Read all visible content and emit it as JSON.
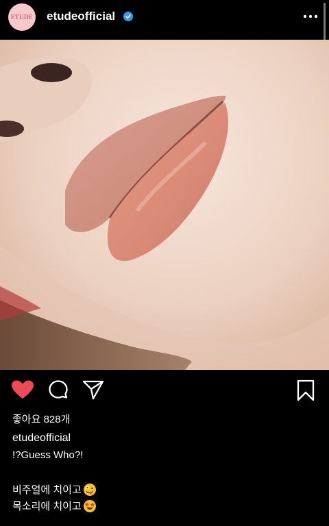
{
  "header": {
    "avatar_text": "ETUDE",
    "username": "etudeofficial",
    "verified_icon": "verified-badge-icon",
    "more_icon": "more-options-icon"
  },
  "post": {
    "image_description_icon": "lips-closeup-photo"
  },
  "actions": {
    "like_icon": "heart-icon",
    "like_color": "#ed4956",
    "comment_icon": "comment-icon",
    "share_icon": "send-icon",
    "save_icon": "bookmark-icon"
  },
  "likes": {
    "text": "좋아요 828개"
  },
  "caption": {
    "username": "etudeofficial",
    "line1": "!?Guess Who?!",
    "line2": "비주얼에 치이고",
    "line2_emoji": "zany-face-emoji",
    "line3": "목소리에 치이고",
    "line3_emoji": "star-struck-emoji"
  }
}
